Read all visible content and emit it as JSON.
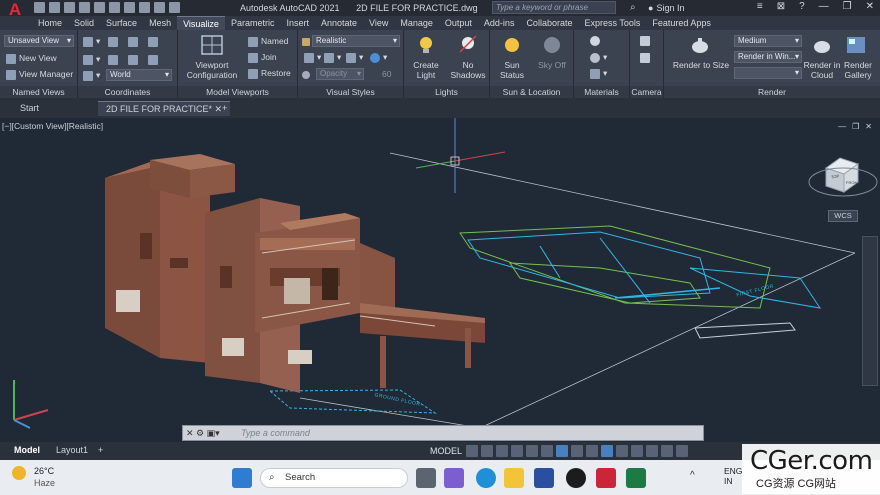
{
  "titlebar": {
    "app_name": "Autodesk AutoCAD 2021",
    "doc_name": "2D FILE FOR PRACTICE.dwg",
    "search_placeholder": "Type a keyword or phrase",
    "signin_label": "Sign In"
  },
  "ribbon_tabs": [
    {
      "label": "Home"
    },
    {
      "label": "Solid"
    },
    {
      "label": "Surface"
    },
    {
      "label": "Mesh"
    },
    {
      "label": "Visualize",
      "active": true
    },
    {
      "label": "Parametric"
    },
    {
      "label": "Insert"
    },
    {
      "label": "Annotate"
    },
    {
      "label": "View"
    },
    {
      "label": "Manage"
    },
    {
      "label": "Output"
    },
    {
      "label": "Add-ins"
    },
    {
      "label": "Collaborate"
    },
    {
      "label": "Express Tools"
    },
    {
      "label": "Featured Apps"
    }
  ],
  "ribbon": {
    "named_views": {
      "title": "Named Views",
      "view_dropdown": "Unsaved View",
      "new_view": "New View",
      "view_manager": "View Manager"
    },
    "coordinates": {
      "title": "Coordinates",
      "ucs_dropdown": "World"
    },
    "model_viewports": {
      "title": "Model Viewports",
      "viewport_config": "Viewport Configuration",
      "named": "Named",
      "join": "Join",
      "restore": "Restore"
    },
    "visual_styles": {
      "title": "Visual Styles",
      "style_dropdown": "Realistic",
      "opacity_label": "Opacity",
      "opacity_value": "60"
    },
    "lights": {
      "title": "Lights",
      "create_light": "Create Light",
      "no_shadows": "No Shadows"
    },
    "sun_location": {
      "title": "Sun & Location",
      "sun_status": "Sun Status",
      "sky_off": "Sky Off"
    },
    "materials": {
      "title": "Materials"
    },
    "camera": {
      "title": "Camera"
    },
    "render": {
      "title": "Render",
      "render_to_size": "Render to Size",
      "quality_dropdown": "Medium",
      "render_in_dropdown": "Render in Win...",
      "render_in_cloud": "Render in Cloud",
      "render_gallery": "Render Gallery"
    }
  },
  "doc_tabs": [
    {
      "label": "Start"
    },
    {
      "label": "2D FILE FOR PRACTICE*",
      "active": true
    }
  ],
  "viewport": {
    "label": "[−][Custom View][Realistic]",
    "wcs_label": "WCS",
    "viewcube_faces": [
      "TOP",
      "FRONT",
      "LEFT"
    ],
    "plan_labels": [
      "FIRST FLOOR",
      "GROUND FLOOR"
    ]
  },
  "command_line": {
    "placeholder": "Type a command"
  },
  "status_bar": {
    "layout_tabs": [
      {
        "label": "Model",
        "active": true
      },
      {
        "label": "Layout1"
      }
    ],
    "add_layout": "+",
    "space_label": "MODEL"
  },
  "taskbar": {
    "weather_temp": "26°C",
    "weather_desc": "Haze",
    "search_label": "Search",
    "lang_line1": "ENG",
    "lang_line2": "IN"
  },
  "watermark": {
    "line1": "CGer.com",
    "line2": "CG资源 CG网站"
  },
  "colors": {
    "accent_red": "#e3283a",
    "viewport_bg": "#202936",
    "plan_cyan": "#2fb7e6",
    "plan_green": "#77c04e",
    "brick": "#7a4b3a"
  }
}
